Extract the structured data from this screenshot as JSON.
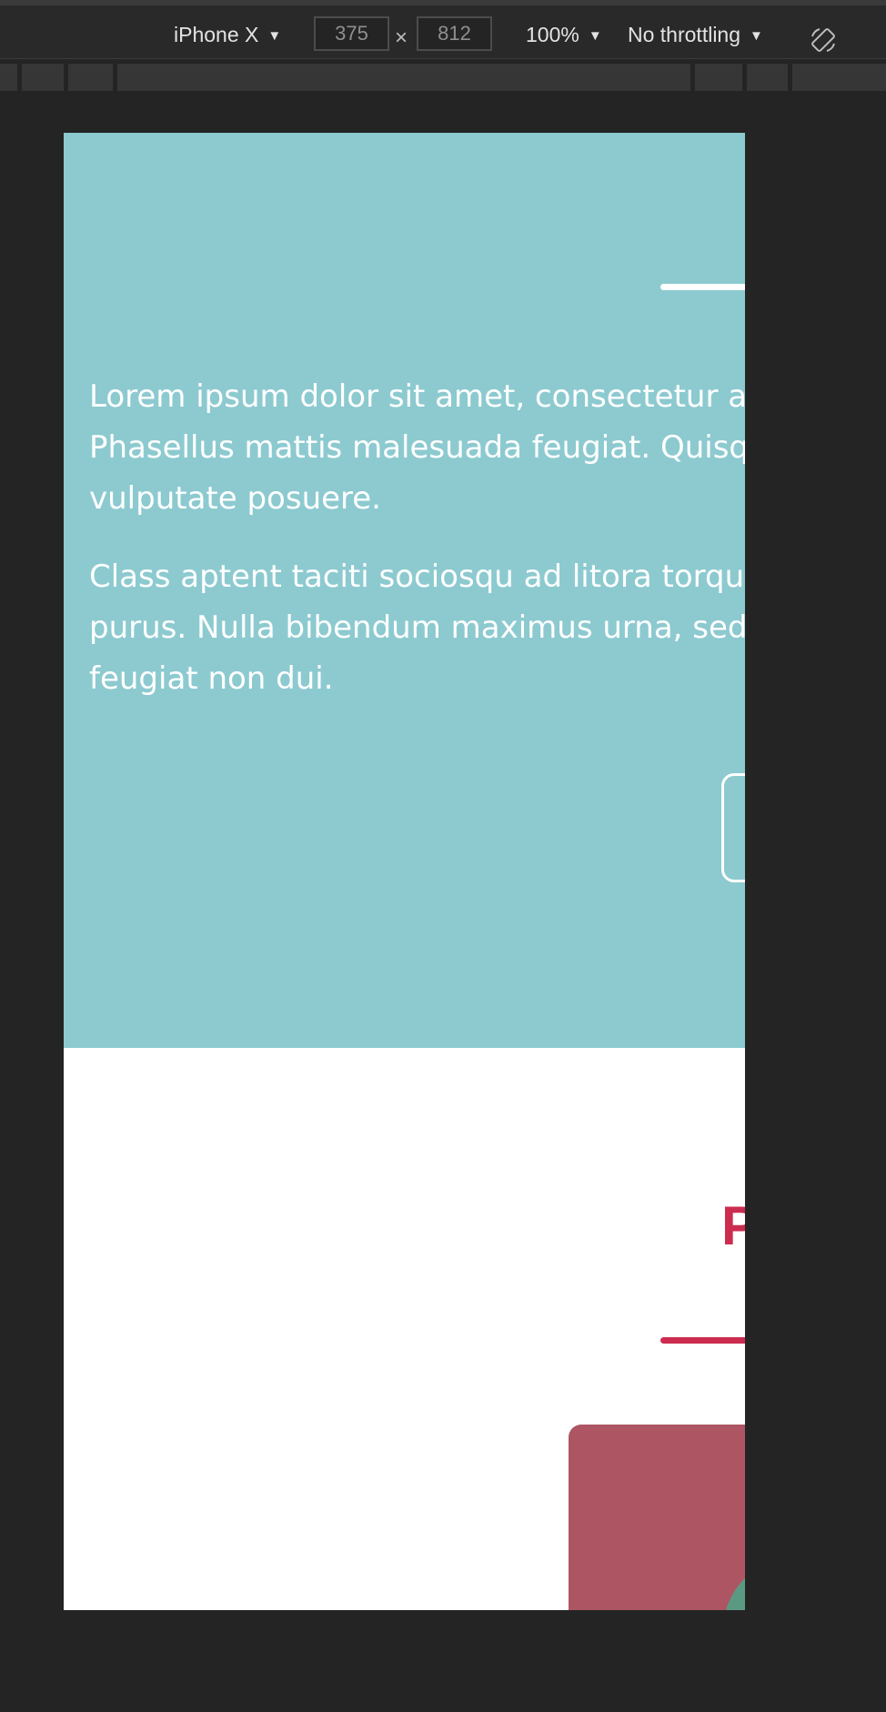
{
  "devtools": {
    "device": {
      "label": "iPhone X",
      "caret": "▼"
    },
    "dimensions": {
      "width": "375",
      "height": "812",
      "separator": "×"
    },
    "zoom": {
      "label": "100%",
      "caret": "▼"
    },
    "throttling": {
      "label": "No throttling",
      "caret": "▼"
    },
    "icons": {
      "rotate": "rotate-icon"
    }
  },
  "page": {
    "hero": {
      "paragraphs": [
        {
          "line1": "Lorem ipsum dolor sit amet, consectetur adip",
          "line2": "Phasellus mattis malesuada feugiat. Quisque",
          "line3": "vulputate posuere."
        },
        {
          "line1": "Class aptent taciti sociosqu ad litora torquen",
          "line2": "purus. Nulla bibendum maximus urna, sed fin",
          "line3": "feugiat non dui."
        }
      ]
    },
    "section": {
      "heading": "P"
    }
  },
  "colors": {
    "hero_background": "#8ccad0",
    "accent": "#cc2c4f",
    "card": "#ad5563",
    "card_shape": "#5b9a82",
    "devtools_background": "#242424"
  }
}
